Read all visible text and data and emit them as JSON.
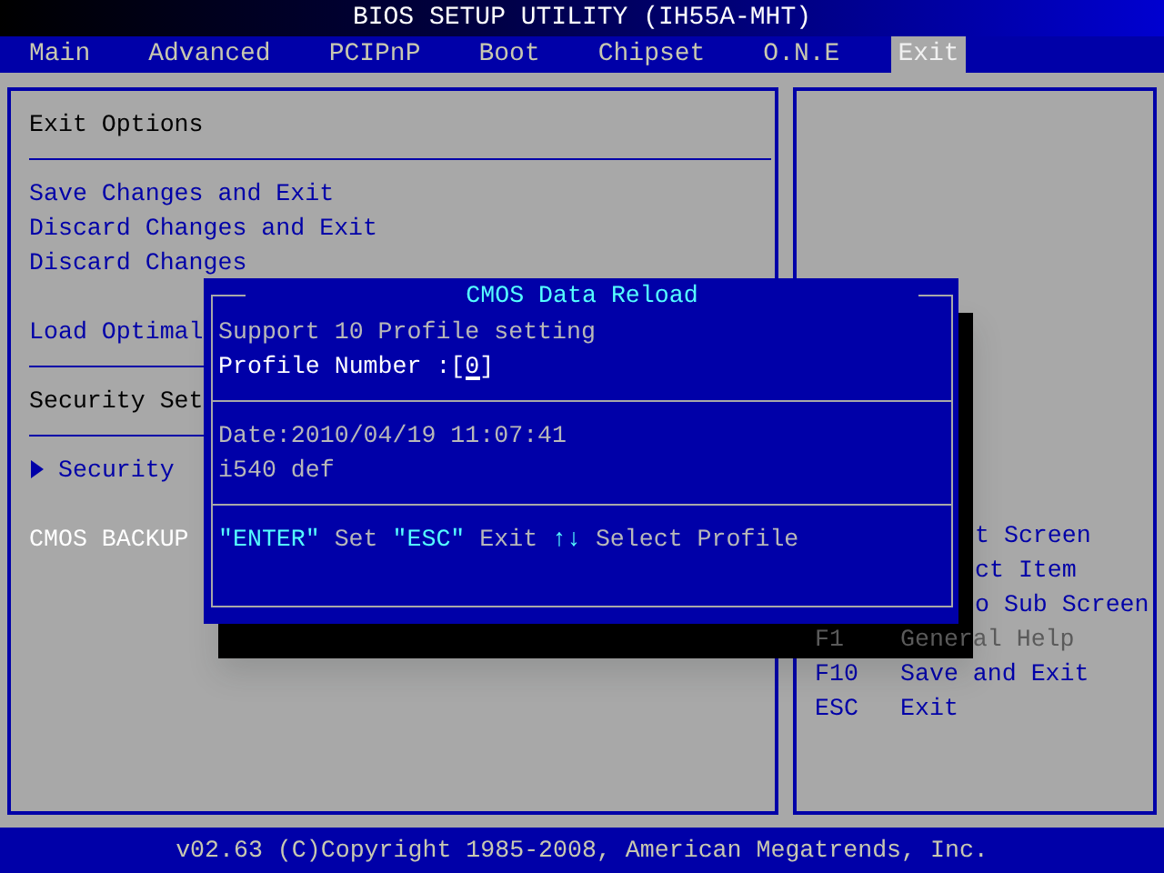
{
  "title": "BIOS SETUP UTILITY (IH55A-MHT)",
  "tabs": [
    {
      "label": "Main",
      "selected": false
    },
    {
      "label": "Advanced",
      "selected": false
    },
    {
      "label": "PCIPnP",
      "selected": false
    },
    {
      "label": "Boot",
      "selected": false
    },
    {
      "label": "Chipset",
      "selected": false
    },
    {
      "label": "O.N.E",
      "selected": false
    },
    {
      "label": "Exit",
      "selected": true
    }
  ],
  "left_panel": {
    "rows": [
      {
        "kind": "heading",
        "text": "Exit Options"
      },
      {
        "kind": "rule"
      },
      {
        "kind": "action",
        "text": "Save Changes and Exit"
      },
      {
        "kind": "action",
        "text": "Discard Changes and Exit"
      },
      {
        "kind": "action",
        "text": "Discard Changes"
      },
      {
        "kind": "spacer"
      },
      {
        "kind": "action",
        "text": "Load Optimal"
      },
      {
        "kind": "rule"
      },
      {
        "kind": "heading",
        "text": "Security Set"
      },
      {
        "kind": "rule"
      },
      {
        "kind": "submenu",
        "text": "Security"
      },
      {
        "kind": "spacer"
      },
      {
        "kind": "info",
        "text": "CMOS BACKUP"
      }
    ]
  },
  "help": [
    {
      "kind": "partial",
      "desc": "t Screen"
    },
    {
      "kind": "partial",
      "desc": "ct Item"
    },
    {
      "kind": "partial",
      "desc": "o Sub Screen"
    },
    {
      "kind": "shadowed",
      "key": "F1",
      "desc": "General Help"
    },
    {
      "kind": "full",
      "key": "F10",
      "desc": "Save and Exit"
    },
    {
      "kind": "full",
      "key": "ESC",
      "desc": "Exit"
    }
  ],
  "dialog": {
    "title": "CMOS Data Reload",
    "note": "Support 10 Profile setting",
    "field": {
      "label": "Profile Number :",
      "value": "[0]"
    },
    "info": [
      "Date:2010/04/19 11:07:41",
      "i540 def"
    ],
    "hints": [
      {
        "key": "\"ENTER\"",
        "action": "Set"
      },
      {
        "key": "\"ESC\"",
        "action": "Exit"
      },
      {
        "key": "↑↓",
        "action": "Select Profile"
      }
    ]
  },
  "footer": "v02.63 (C)Copyright 1985-2008, American Megatrends, Inc."
}
